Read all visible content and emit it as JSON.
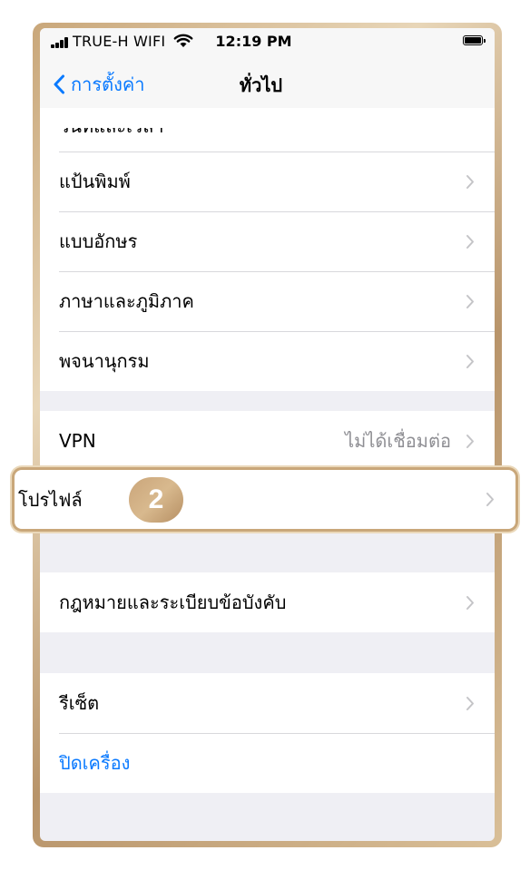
{
  "status_bar": {
    "carrier": "TRUE-H WIFI",
    "time": "12:19 PM"
  },
  "nav": {
    "back_label": "การตั้งค่า",
    "title": "ทั่วไป"
  },
  "group1": {
    "cut_item": "วันที่และเวลา",
    "items": [
      {
        "label": "แป้นพิมพ์"
      },
      {
        "label": "แบบอักษร"
      },
      {
        "label": "ภาษาและภูมิภาค"
      },
      {
        "label": "พจนานุกรม"
      }
    ]
  },
  "group2": {
    "vpn_label": "VPN",
    "vpn_status": "ไม่ได้เชื่อมต่อ",
    "profile_label": "โปรไฟล์"
  },
  "callout": {
    "step_number": "2",
    "accent_color": "#c9a77a"
  },
  "group3": {
    "legal_label": "กฎหมายและระเบียบข้อบังคับ"
  },
  "group4": {
    "reset_label": "รีเซ็ต",
    "shutdown_label": "ปิดเครื่อง"
  },
  "colors": {
    "ios_blue": "#0a7aff",
    "detail_gray": "#8e8e93"
  }
}
